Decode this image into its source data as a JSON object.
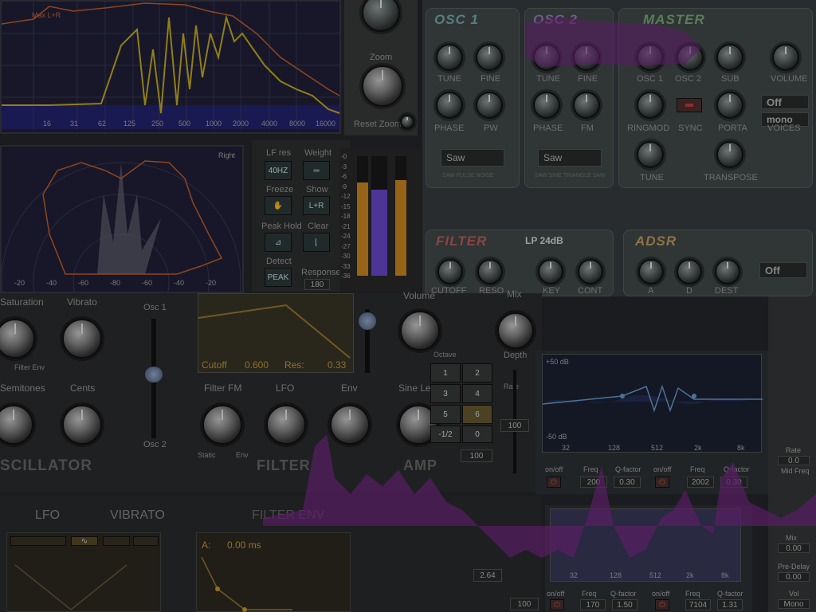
{
  "analyzer": {
    "legend": "Max L+R",
    "freq_ticks": [
      "16",
      "31",
      "62",
      "125",
      "250",
      "500",
      "1000",
      "2000",
      "4000",
      "8000",
      "16000"
    ]
  },
  "scope": {
    "right_label": "Right",
    "ticks": [
      "-20",
      "-40",
      "-60",
      "-80",
      "-60",
      "-40",
      "-20"
    ]
  },
  "analyzer_controls": {
    "zoom_label": "Zoom",
    "reset_zoom_label": "Reset Zoom",
    "lf_res_label": "LF res",
    "lf_res_value": "40HZ",
    "weight_label": "Weight",
    "freeze_label": "Freeze",
    "show_label": "Show",
    "show_value": "L+R",
    "peak_hold_label": "Peak Hold",
    "clear_label": "Clear",
    "detect_label": "Detect",
    "detect_value": "PEAK",
    "response_label": "Response",
    "response_value": "180"
  },
  "meter": {
    "scale": [
      "-0",
      "-3",
      "-6",
      "-9",
      "-12",
      "-15",
      "-18",
      "-21",
      "-24",
      "-27",
      "-30",
      "-33",
      "-36"
    ],
    "levels": {
      "left": 0.78,
      "mid": 0.72,
      "right": 0.8
    }
  },
  "synth": {
    "osc1_title": "OSC 1",
    "osc2_title": "OSC 2",
    "master_title": "MASTER",
    "osc1_knobs": [
      "TUNE",
      "FINE",
      "PHASE",
      "PW"
    ],
    "osc2_knobs": [
      "TUNE",
      "FINE",
      "PHASE",
      "FM"
    ],
    "master_knobs": [
      "OSC 1",
      "OSC 2",
      "SUB",
      "VOLUME",
      "RINGMOD",
      "SYNC",
      "PORTA",
      "VOICES",
      "TUNE",
      "TRANSPOSE"
    ],
    "osc1_wave": "Saw",
    "osc2_wave": "Saw",
    "osc1_wave_hint": "SAW PULSE NOISE",
    "osc2_wave_hint": "SAW SINE TRIANGLE SAW",
    "porta_value": "Off",
    "voices_value": "mono",
    "filter_title": "FILTER",
    "filter_type": "LP 24dB",
    "filter_knobs": [
      "CUTOFF",
      "RESO",
      "KEY",
      "CONT"
    ],
    "adsr_title": "ADSR",
    "adsr_knobs": [
      "A",
      "D",
      "DEST"
    ],
    "adsr_value": "Off"
  },
  "oscillator_section": {
    "title": "SCILLATOR",
    "saturation_label": "Saturation",
    "vibrato_label": "Vibrato",
    "semitones_label": "Semitones",
    "cents_label": "Cents",
    "filter_env_label": "Filter Env",
    "osc1_label": "Osc 1",
    "osc2_label": "Osc 2"
  },
  "filter_section": {
    "title": "FILTER",
    "cutoff_label": "Cutoff",
    "cutoff_value": "0.600",
    "res_label": "Res:",
    "res_value": "0.33",
    "filter_fm_label": "Filter FM",
    "lfo_label": "LFO",
    "env_label": "Env",
    "static_label": "Static",
    "env_short_label": "Env"
  },
  "amp_section": {
    "title": "AMP",
    "volume_label": "Volume",
    "sine_level_label": "Sine Level",
    "mix_label": "Mix",
    "depth_label": "Depth",
    "rate_label": "Rate",
    "depth_value": "100",
    "buttons": [
      "1",
      "2",
      "3",
      "4",
      "5",
      "6",
      "-1/2",
      "0"
    ],
    "voices_value": "100",
    "octave_label": "Octave"
  },
  "mod_section": {
    "lfo_label": "LFO",
    "vibrato_label": "VIBRATO",
    "filter_env_label": "FILTER ENV",
    "attack_label": "A:",
    "attack_value": "0.00 ms",
    "value_a": "2.64",
    "value_b": "100"
  },
  "eq": {
    "top_db": "+50 dB",
    "bottom_db": "-50 dB",
    "freq_ticks": [
      "32",
      "128",
      "512",
      "2k",
      "8k"
    ],
    "band_labels": [
      "on/off",
      "Freq",
      "Q-factor",
      "on/off",
      "Freq",
      "Q-factor"
    ],
    "band_values": [
      "200",
      "0.30",
      "2002",
      "0.30"
    ],
    "lower_band_values": [
      "170",
      "1.50",
      "7104",
      "1.31"
    ],
    "lower_freq_ticks": [
      "32",
      "128",
      "512",
      "2k",
      "8k"
    ]
  },
  "right_column": {
    "labels": [
      "Rate",
      "Mid Freq",
      "Mix",
      "Pre-Delay",
      "Vol"
    ],
    "values": [
      "0.0",
      "0.00",
      "0.00",
      "Mono"
    ]
  },
  "colors": {
    "accent_purple": "#7a2a8a",
    "analyzer_yellow": "#c8b020",
    "analyzer_orange": "#c8602a",
    "osc1_teal": "#4aa0a0",
    "osc2_purple": "#8a4aaa",
    "master_green": "#4a9a4a",
    "filter_red": "#b04040",
    "adsr_orange": "#c88a30",
    "meter_orange": "#d08a20",
    "meter_purple": "#6a4ad0"
  }
}
